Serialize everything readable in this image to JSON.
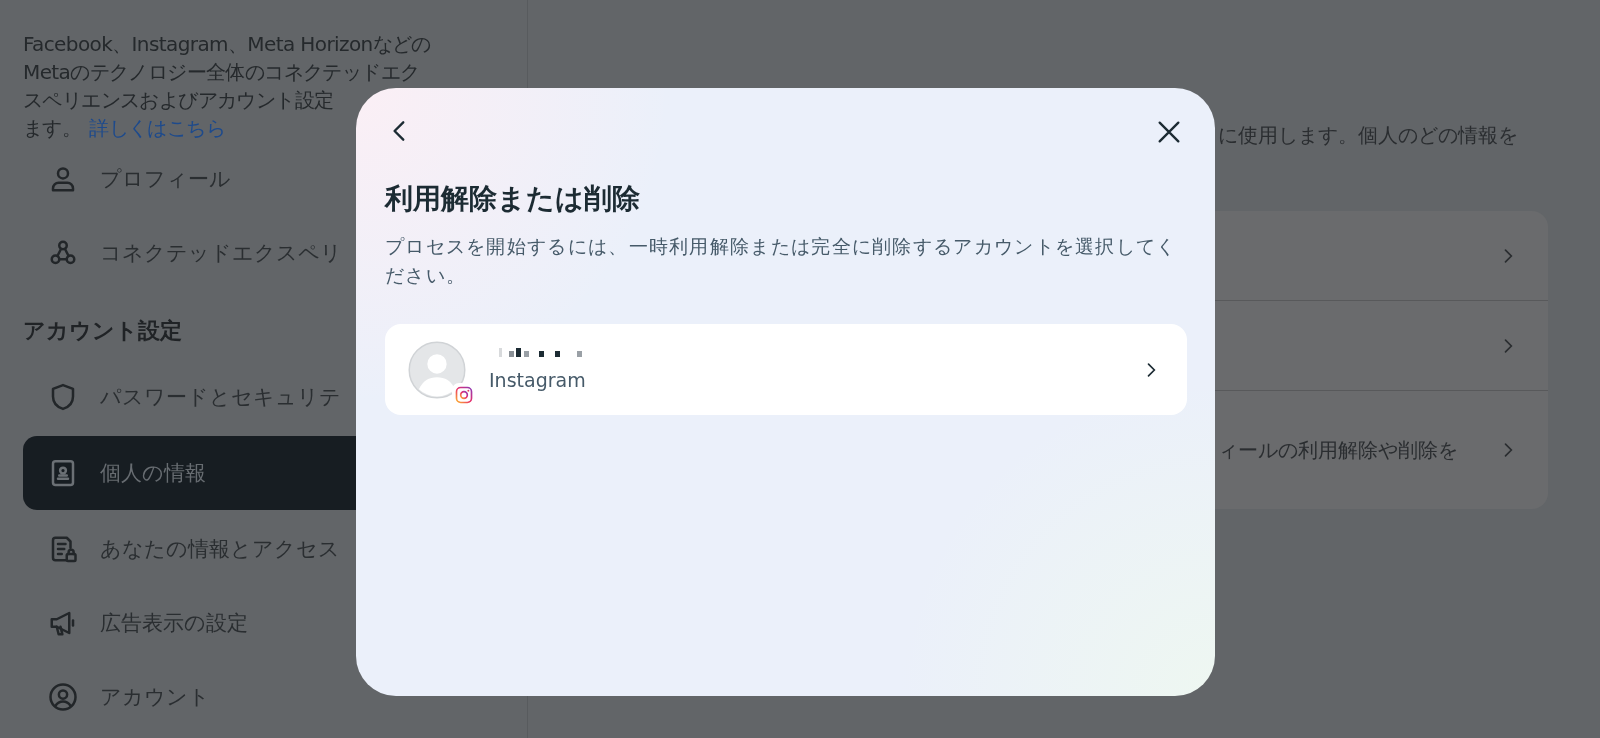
{
  "sidebar": {
    "description_lines": [
      "Facebook、Instagram、Meta Horizonなどの",
      "Metaのテクノロジー全体のコネクテッドエク",
      "スペリエンスおよびアカウント設定",
      "ます。"
    ],
    "link": "詳しくはこちら",
    "items": [
      {
        "kind": "item",
        "label": "プロフィール",
        "selected": false
      },
      {
        "kind": "item",
        "label": "コネクテッドエクスペリ",
        "selected": false
      },
      {
        "kind": "heading",
        "label": "アカウント設定"
      },
      {
        "kind": "item",
        "label": "パスワードとセキュリテ",
        "selected": false
      },
      {
        "kind": "item",
        "label": "個人の情報",
        "selected": true
      },
      {
        "kind": "item",
        "label": "あなたの情報とアクセス",
        "selected": false
      },
      {
        "kind": "item",
        "label": "広告表示の設定",
        "selected": false
      },
      {
        "kind": "item",
        "label": "アカウント",
        "selected": false
      }
    ]
  },
  "main": {
    "description": "に使用します。個人のどの情報を",
    "rows": [
      {
        "kind": "blank"
      },
      {
        "kind": "blank"
      },
      {
        "kind": "text",
        "text": "ィールの利用解除や削除を"
      }
    ]
  },
  "dialog": {
    "title": "利用解除または削除",
    "description": "プロセスを開始するには、一時利用解除または完全に削除するアカウントを選択してください。",
    "accounts": [
      {
        "platform": "Instagram"
      }
    ]
  }
}
